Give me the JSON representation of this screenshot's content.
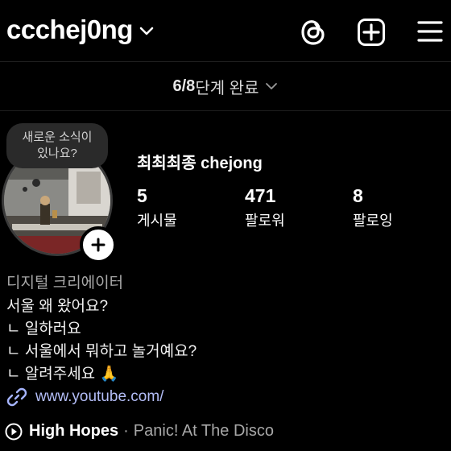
{
  "header": {
    "username": "ccchej0ng"
  },
  "onboarding": {
    "steps": "6/8",
    "label": "단계 완료"
  },
  "note": {
    "line1": "새로운 소식이",
    "line2": "있나요?"
  },
  "profile": {
    "full_name": "최최최종 chejong",
    "stats": [
      {
        "value": "5",
        "label": "게시물"
      },
      {
        "value": "471",
        "label": "팔로워"
      },
      {
        "value": "8",
        "label": "팔로잉"
      }
    ],
    "category": "디지털 크리에이터",
    "bio": [
      "서울 왜 왔어요?",
      "ㄴ 일하러요",
      "ㄴ 서울에서 뭐하고 놀거예요?",
      "ㄴ 알려주세요 🙏"
    ],
    "link": "www.youtube.com/",
    "music": {
      "song": "High Hopes",
      "separator": "·",
      "artist": "Panic! At The Disco"
    }
  },
  "colors": {
    "background": "#000000",
    "link": "#a5b4fc",
    "secondary_text": "#a8a8a8"
  },
  "icons": [
    "chevron-down-icon",
    "threads-icon",
    "add-icon",
    "menu-icon",
    "link-icon",
    "play-icon",
    "plus-icon"
  ]
}
